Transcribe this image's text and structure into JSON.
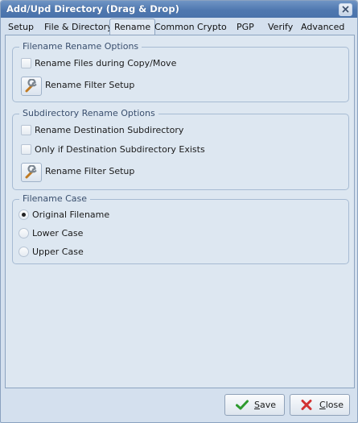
{
  "window": {
    "title": "Add/Upd Directory (Drag & Drop)"
  },
  "tabs": [
    {
      "label": "Setup"
    },
    {
      "label": "File & Directory"
    },
    {
      "label": "Rename",
      "active": true
    },
    {
      "label": "Common"
    },
    {
      "label": "Crypto"
    },
    {
      "label": "PGP"
    },
    {
      "label": "Verify"
    },
    {
      "label": "Advanced"
    }
  ],
  "filename_rename": {
    "legend": "Filename Rename Options",
    "rename_files": {
      "label": "Rename Files during Copy/Move",
      "checked": false
    },
    "filter_setup_label": "Rename Filter Setup"
  },
  "subdir_rename": {
    "legend": "Subdirectory Rename Options",
    "rename_dest": {
      "label": "Rename Destination Subdirectory",
      "checked": false
    },
    "only_if_exists": {
      "label": "Only if Destination Subdirectory Exists",
      "checked": false
    },
    "filter_setup_label": "Rename Filter Setup"
  },
  "filename_case": {
    "legend": "Filename Case",
    "options": [
      {
        "label": "Original Filename",
        "selected": true
      },
      {
        "label": "Lower Case",
        "selected": false
      },
      {
        "label": "Upper Case",
        "selected": false
      }
    ]
  },
  "buttons": {
    "save": {
      "label_first": "S",
      "label_rest": "ave"
    },
    "close": {
      "label_first": "C",
      "label_rest": "lose"
    }
  },
  "colors": {
    "title_bar": "#4f78b0",
    "save_check": "#2e9a2e",
    "close_x": "#d23232"
  },
  "icons": {
    "close": "close-icon",
    "filter": "wrench-icon",
    "save": "checkmark-icon",
    "cancel": "x-icon"
  }
}
